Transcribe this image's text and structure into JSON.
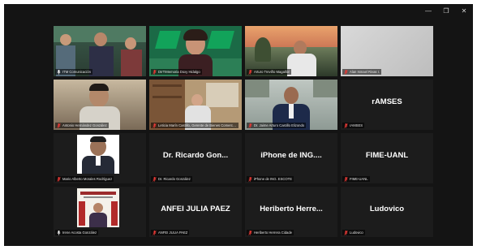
{
  "window": {
    "controls": [
      "minimize",
      "restore",
      "close"
    ]
  },
  "participants": [
    {
      "name": "ITM Comunicación",
      "big_label": "",
      "muted": false,
      "speaking": true,
      "video": "group"
    },
    {
      "name": "DIrTIMemoria Doxy Hidalgo",
      "big_label": "",
      "muted": true,
      "speaking": false,
      "video": "woman-logo"
    },
    {
      "name": "Arturo Treviño Magallón",
      "big_label": "",
      "muted": true,
      "speaking": false,
      "video": "sunset"
    },
    {
      "name": "Alan Ismael Rivas I.",
      "big_label": "",
      "muted": true,
      "speaking": false,
      "video": "blank"
    },
    {
      "name": "Antonio Hernández González",
      "big_label": "",
      "muted": true,
      "speaking": false,
      "video": "man-desk"
    },
    {
      "name": "Leticia Marín Castillo, Gerente de Bienes Comerciales UDAN",
      "big_label": "",
      "muted": true,
      "speaking": false,
      "video": "office"
    },
    {
      "name": "Dr. Jaime Arturo Castillo Elizondo",
      "big_label": "",
      "muted": true,
      "speaking": false,
      "video": "man-suit"
    },
    {
      "name": "rAMSES",
      "big_label": "rAMSES",
      "muted": true,
      "speaking": false,
      "video": "none"
    },
    {
      "name": "Mario Alberto Morales Rodríguez",
      "big_label": "",
      "muted": true,
      "speaking": false,
      "video": "portrait"
    },
    {
      "name": "Dr. Ricardo González",
      "big_label": "Dr. Ricardo Gon...",
      "muted": true,
      "speaking": false,
      "video": "none"
    },
    {
      "name": "iPhone de ING. ESCOTE",
      "big_label": "iPhone de ING....",
      "muted": true,
      "speaking": false,
      "video": "none"
    },
    {
      "name": "FIME-UANL",
      "big_label": "FIME-UANL",
      "muted": true,
      "speaking": false,
      "video": "none"
    },
    {
      "name": "Irene Acosta González",
      "big_label": "",
      "muted": false,
      "speaking": false,
      "video": "poster"
    },
    {
      "name": "ANFEI JULIA PAEZ",
      "big_label": "ANFEI JULIA PAEZ",
      "muted": true,
      "speaking": false,
      "video": "none"
    },
    {
      "name": "Heriberto Herrera Cidade",
      "big_label": "Heriberto  Herre...",
      "muted": true,
      "speaking": false,
      "video": "none"
    },
    {
      "name": "Ludovico",
      "big_label": "Ludovico",
      "muted": true,
      "speaking": false,
      "video": "none"
    }
  ],
  "colors": {
    "window_bg": "#141414",
    "tile_bg": "#1c1c1c",
    "speaking_outline": "#22c55e",
    "muted_icon": "#e53935"
  }
}
